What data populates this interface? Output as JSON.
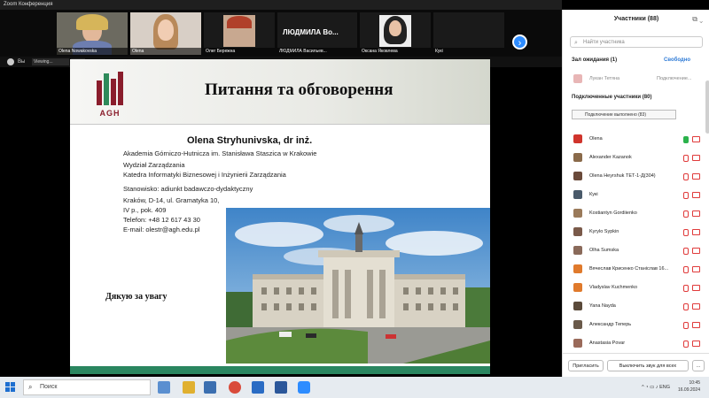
{
  "window": {
    "title": "Zoom Конференция"
  },
  "gallery": {
    "tiles": [
      {
        "name": "Olena Nowakovska"
      },
      {
        "name": "Olena"
      },
      {
        "name": "Олег Бережна"
      },
      {
        "name": "ЛЮДМИЛА Во...",
        "subname": "ЛЮДМИЛА Васильев..."
      },
      {
        "name": "Оксана Яковлева"
      },
      {
        "name": "Кукі"
      }
    ],
    "next_icon": "chevron-right-icon"
  },
  "share": {
    "label": "Вы",
    "badge": "Viewing..."
  },
  "slide": {
    "logo_text": "AGH",
    "title": "Питання та обговорення",
    "author": "Olena Stryhunivska, dr inż.",
    "lines": [
      "Akademia Górniczo-Hutnicza im. Stanisława Staszica w Krakowie",
      "Wydział Zarządzania",
      "Katedra Informatyki Biznesowej i Inżynierii Zarządzania",
      "Stanowisko: adiunkt badawczo-dydaktyczny",
      "Kraków, D-14, ul. Gramatyka 10,",
      "IV p., pok. 409",
      "Telefon: +48 12 617 43 30",
      "E-mail: olestr@agh.edu.pl"
    ],
    "thanks": "Дякую за увагу"
  },
  "participants_panel": {
    "title": "Участники (88)",
    "search_placeholder": "Найти участника",
    "waiting_header": "Зал ожидания (1)",
    "admit_all": "Свободно",
    "waiting": [
      {
        "name": "Лукан Тетяна",
        "action": "Подключение..."
      }
    ],
    "in_meeting_header": "Подключенные участники (80)",
    "tooltip": "Подключение выполнено (83)",
    "people": [
      {
        "name": "Olena",
        "color": "#d0342c"
      },
      {
        "name": "Alexander Kazanok",
        "color": "#8a6a4a"
      },
      {
        "name": "Olena Heyrshuk ТЕТ-1-Д(304)",
        "color": "#6a4a3a"
      },
      {
        "name": "Кукі",
        "color": "#4a5a6a"
      },
      {
        "name": "Kostiantyn Gordiienko",
        "color": "#9a7a5a"
      },
      {
        "name": "Kyrylo Sypkin",
        "color": "#7a5a4a"
      },
      {
        "name": "Olha Sumska",
        "color": "#8a6a5a"
      },
      {
        "name": "Вячеслав Крисенко Станіслав 16...",
        "color": "#e07a2c"
      },
      {
        "name": "Vladyslav Kuchmenko",
        "color": "#e07a2c"
      },
      {
        "name": "Yana Nayda",
        "color": "#5a4a3a"
      },
      {
        "name": "Александр Теперь",
        "color": "#6a5a4a"
      },
      {
        "name": "Anastasia Povar",
        "color": "#9a6a5a"
      }
    ],
    "invite_button": "Пригласить",
    "mute_all_button": "Выключить звук для всех",
    "more_button": "..."
  },
  "taskbar": {
    "search_placeholder": "Поиск",
    "tray_text": "ENG",
    "time": "10:45",
    "date": "16.09.2024"
  }
}
